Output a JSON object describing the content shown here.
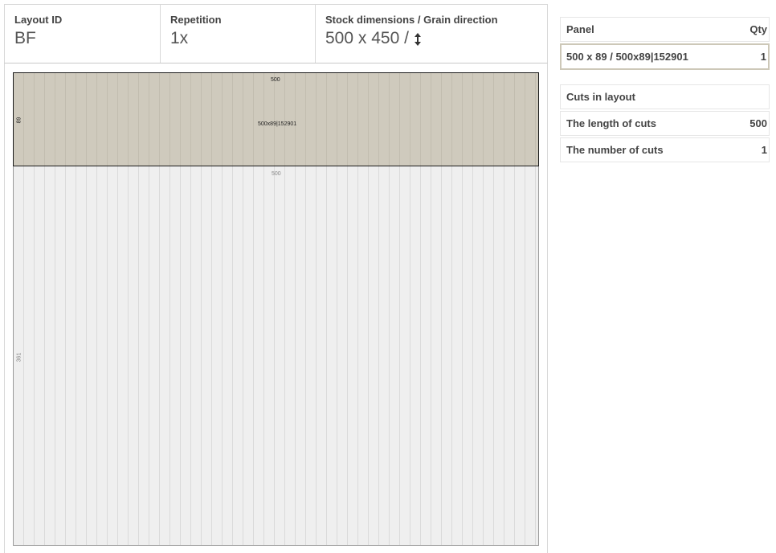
{
  "header": {
    "layout_id_label": "Layout ID",
    "layout_id_value": "BF",
    "repetition_label": "Repetition",
    "repetition_value": "1x",
    "stock_label": "Stock dimensions / Grain direction",
    "stock_value": "500 x 450 /",
    "grain_icon": "vertical-double-arrow-icon"
  },
  "layout": {
    "panel": {
      "width_label": "500",
      "height_label": "89",
      "name": "500x89|152901",
      "fill_color": "#cfcabd"
    },
    "offcut": {
      "width_label": "500",
      "height_label": "361",
      "fill_color": "#efefef"
    }
  },
  "panels_table": {
    "col_panel": "Panel",
    "col_qty": "Qty",
    "rows": [
      {
        "panel": "500 x 89 / 500x89|152901",
        "qty": "1"
      }
    ]
  },
  "cuts_table": {
    "title": "Cuts in layout",
    "length_label": "The length of cuts",
    "length_value": "500",
    "count_label": "The number of cuts",
    "count_value": "1"
  }
}
